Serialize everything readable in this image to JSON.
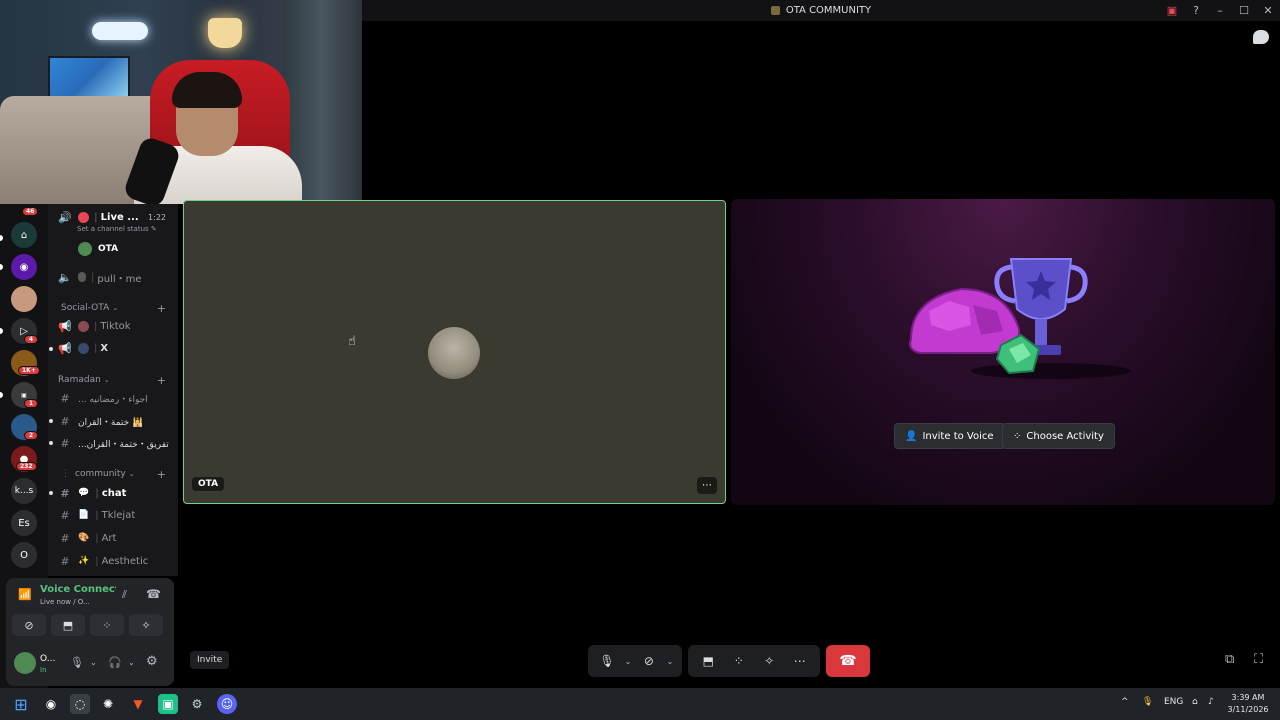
{
  "window": {
    "title": "OTA COMMUNITY"
  },
  "rail": {
    "badges": [
      "46",
      "4",
      "1K+",
      "1",
      "2",
      "232"
    ],
    "text_servers": [
      "k...s",
      "Es",
      "O"
    ]
  },
  "channels": {
    "live_channel": {
      "name": "Live ...",
      "time": "1:22",
      "status_hint": "Set a channel status"
    },
    "live_member": "OTA",
    "voice_pull": "pull・me",
    "cat_social": "Social-OTA",
    "tiktok": "Tiktok",
    "x": "X",
    "cat_ramadan": "Ramadan",
    "ramadan_1": "... اجواء・رمضانيه",
    "ramadan_2": "ختمة・القران 🕌",
    "ramadan_3": "...تفريق・ختمة・القران",
    "cat_community": "community",
    "chat": "chat",
    "tklejat": "Tklejat",
    "art": "Art",
    "aesthetic": "Aesthetic"
  },
  "voice_panel": {
    "status": "Voice Connected",
    "sub": "Live now / O...",
    "user_name": "O...",
    "user_status": "In"
  },
  "stage": {
    "tile_name": "OTA",
    "invite_to_voice": "Invite to Voice",
    "choose_activity": "Choose Activity"
  },
  "controls": {
    "invite": "Invite"
  },
  "taskbar": {
    "lang": "ENG",
    "time": "3:39 AM",
    "date": "3/11/2026"
  },
  "colors": {
    "accent_green": "#57c17e",
    "hangup_red": "#da373c",
    "badge_red": "#d83c3e"
  }
}
